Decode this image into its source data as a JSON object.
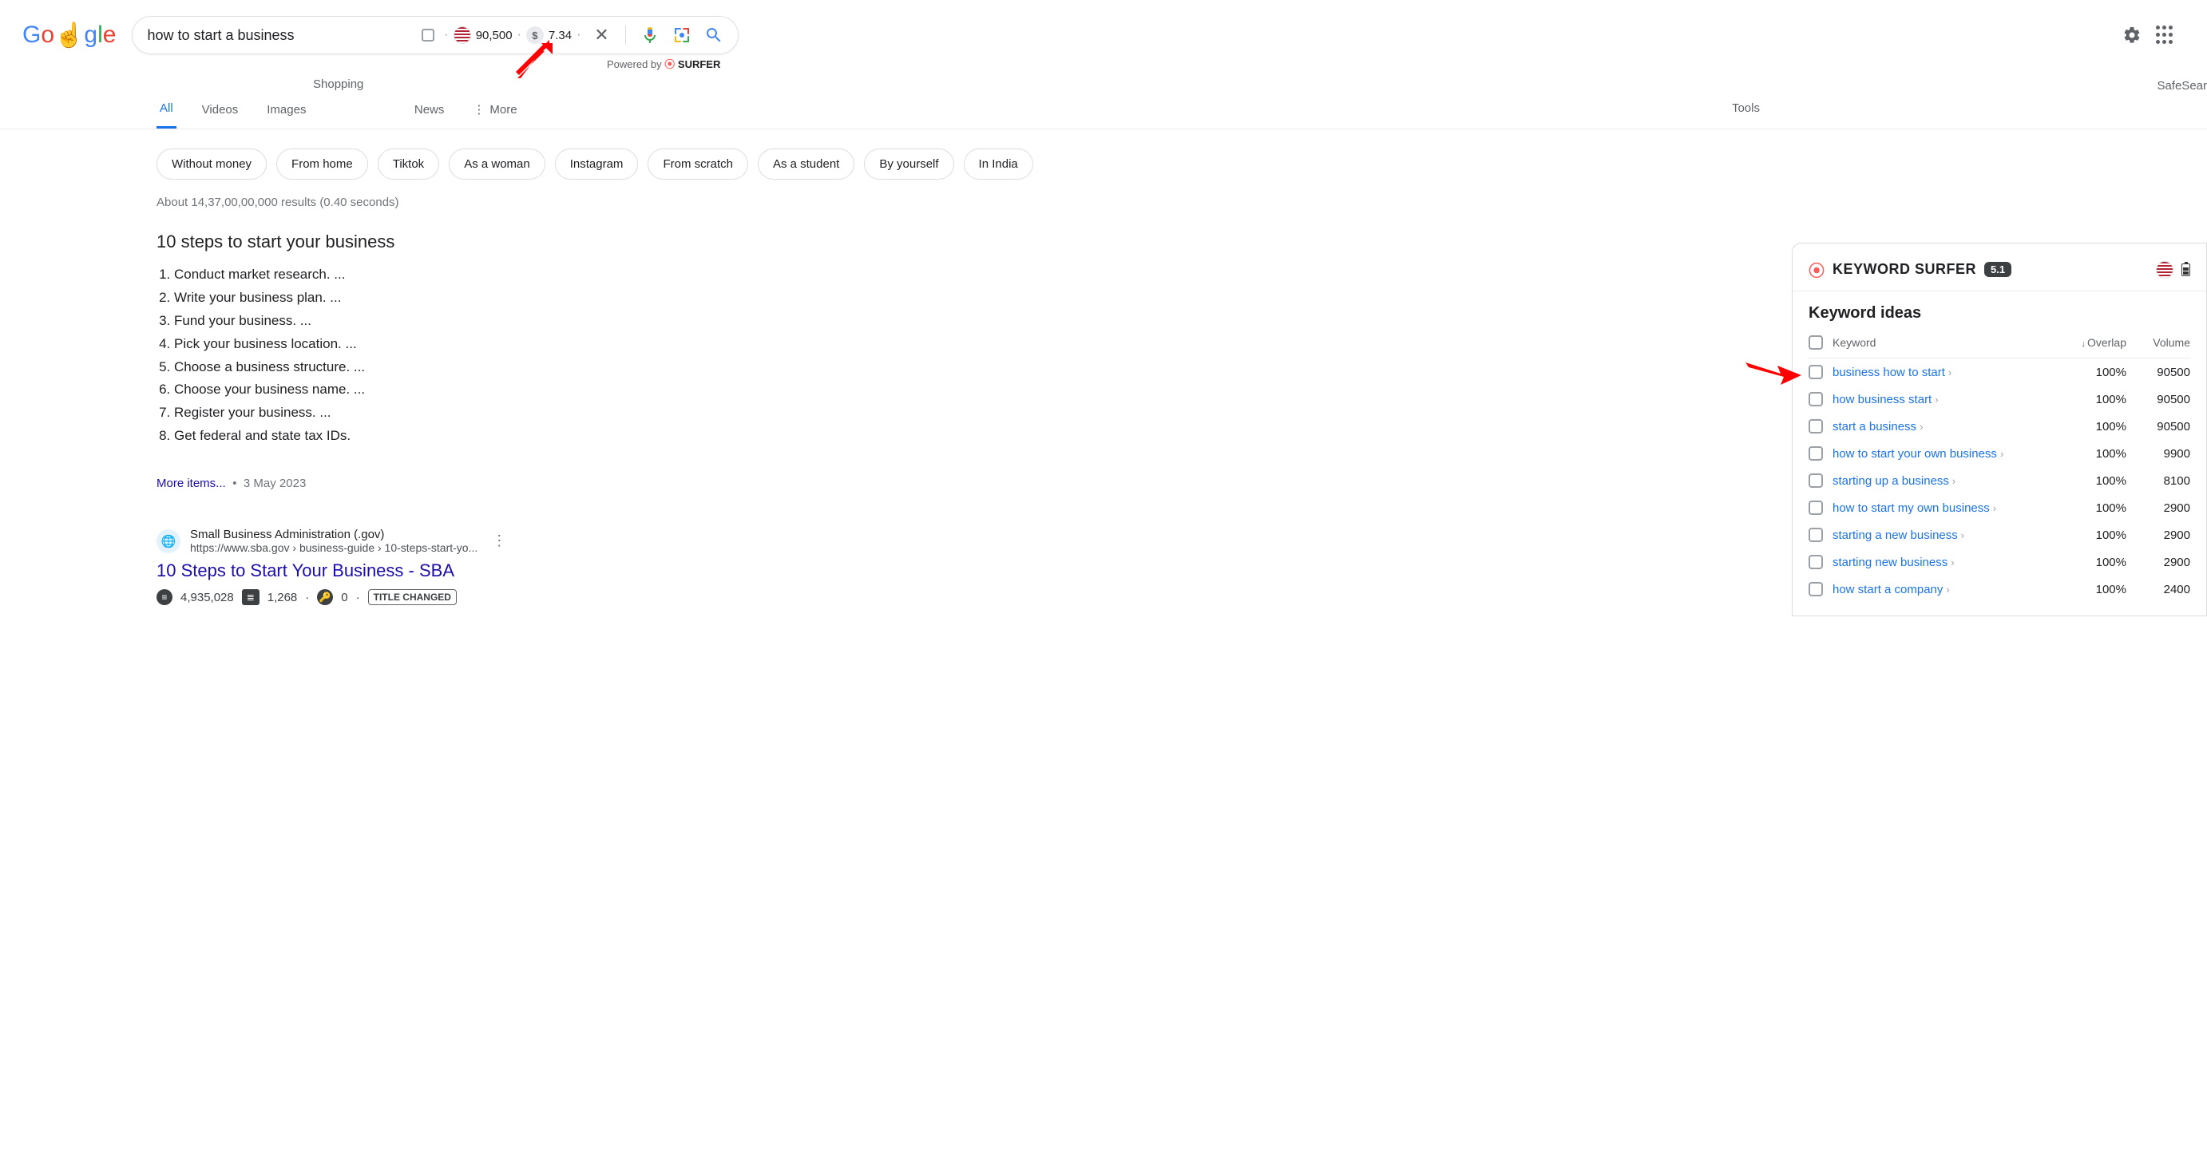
{
  "search": {
    "query": "how to start a business",
    "volume": "90,500",
    "cpc": "7.34"
  },
  "powered_by": {
    "prefix": "Powered by",
    "brand": "SURFER"
  },
  "tabs": {
    "all": "All",
    "videos": "Videos",
    "images": "Images",
    "shopping": "Shopping",
    "news": "News",
    "more": "More",
    "tools": "Tools",
    "safesearch": "SafeSear"
  },
  "chips": [
    "Without money",
    "From home",
    "Tiktok",
    "As a woman",
    "Instagram",
    "From scratch",
    "As a student",
    "By yourself",
    "In India"
  ],
  "result_stats": "About 14,37,00,00,000 results (0.40 seconds)",
  "featured": {
    "title": "10 steps to start your business",
    "items": [
      "Conduct market research. ...",
      "Write your business plan. ...",
      "Fund your business. ...",
      "Pick your business location. ...",
      "Choose a business structure. ...",
      "Choose your business name. ...",
      "Register your business. ...",
      "Get federal and state tax IDs."
    ],
    "more": "More items...",
    "date": "3 May 2023"
  },
  "result1": {
    "site": "Small Business Administration (.gov)",
    "url": "https://www.sba.gov › business-guide › 10-steps-start-yo...",
    "title": "10 Steps to Start Your Business - SBA",
    "traffic": "4,935,028",
    "words": "1,268",
    "keywords": "0",
    "title_changed": "TITLE CHANGED"
  },
  "ks": {
    "brand": "KEYWORD SURFER",
    "version": "5.1",
    "card_title": "Keyword ideas",
    "col_keyword": "Keyword",
    "col_overlap": "Overlap",
    "col_volume": "Volume",
    "rows": [
      {
        "kw": "business how to start",
        "ov": "100%",
        "vol": "90500"
      },
      {
        "kw": "how business start",
        "ov": "100%",
        "vol": "90500"
      },
      {
        "kw": "start a business",
        "ov": "100%",
        "vol": "90500"
      },
      {
        "kw": "how to start your own business",
        "ov": "100%",
        "vol": "9900"
      },
      {
        "kw": "starting up a business",
        "ov": "100%",
        "vol": "8100"
      },
      {
        "kw": "how to start my own business",
        "ov": "100%",
        "vol": "2900"
      },
      {
        "kw": "starting a new business",
        "ov": "100%",
        "vol": "2900"
      },
      {
        "kw": "starting new business",
        "ov": "100%",
        "vol": "2900"
      },
      {
        "kw": "how start a company",
        "ov": "100%",
        "vol": "2400"
      }
    ]
  }
}
